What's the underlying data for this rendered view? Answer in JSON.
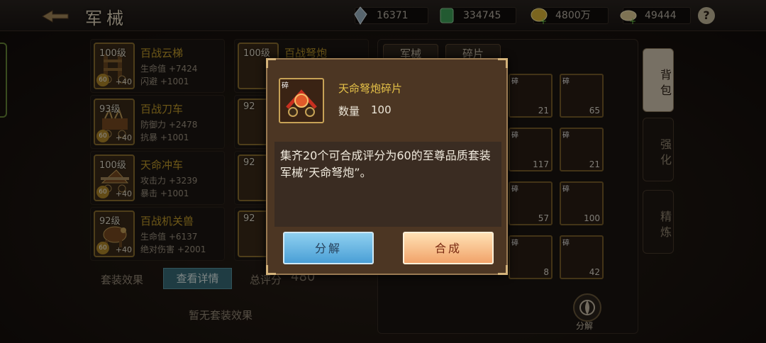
{
  "header": {
    "title": "军械",
    "resources": [
      {
        "icon": "crystal-icon",
        "value": "16371"
      },
      {
        "icon": "jade-icon",
        "value": "334745"
      },
      {
        "icon": "gold-icon",
        "value": "4800万"
      },
      {
        "icon": "food-icon",
        "value": "49444"
      }
    ],
    "help": "?"
  },
  "equipment_list": [
    {
      "level": "100级",
      "name": "百战云梯",
      "stat1": "生命值 +7424",
      "stat2": "闪避 +1001",
      "star": "60",
      "plus": "+40"
    },
    {
      "level": "93级",
      "name": "百战刀车",
      "stat1": "防御力 +2478",
      "stat2": "抗暴 +1001",
      "star": "60",
      "plus": "+40"
    },
    {
      "level": "100级",
      "name": "天命冲车",
      "stat1": "攻击力 +3239",
      "stat2": "暴击 +1001",
      "star": "60",
      "plus": "+40"
    },
    {
      "level": "92级",
      "name": "百战机关兽",
      "stat1": "生命值 +6137",
      "stat2": "绝对伤害 +2001",
      "star": "60",
      "plus": "+40"
    }
  ],
  "second_column": [
    {
      "level": "100级",
      "name": "百战弩炮"
    },
    {
      "level": "92"
    },
    {
      "level": "92"
    },
    {
      "level": "92"
    }
  ],
  "set_effect": {
    "label": "套装效果",
    "detail_button": "查看详情",
    "score_label": "总评分",
    "score_value": "480",
    "none_text": "暂无套装效果"
  },
  "right_panel": {
    "tabs": [
      "军械",
      "碎片"
    ],
    "fragments": [
      {
        "tag": "碎",
        "count": "21"
      },
      {
        "tag": "碎",
        "count": "65"
      },
      {
        "tag": "碎",
        "count": "117"
      },
      {
        "tag": "碎",
        "count": "21"
      },
      {
        "tag": "碎",
        "count": "57"
      },
      {
        "tag": "碎",
        "count": "100"
      },
      {
        "tag": "碎",
        "count": "8"
      },
      {
        "tag": "碎",
        "count": "42"
      }
    ],
    "decompose_label": "分解"
  },
  "side_tabs": [
    "背包",
    "强化",
    "精炼"
  ],
  "modal": {
    "item_tag": "碎",
    "item_name": "天命弩炮碎片",
    "qty_label": "数量",
    "qty_value": "100",
    "description": "集齐20个可合成评分为60的至尊品质套装军械“天命弩炮”。",
    "buttons": {
      "decompose": "分解",
      "compose": "合成"
    }
  }
}
